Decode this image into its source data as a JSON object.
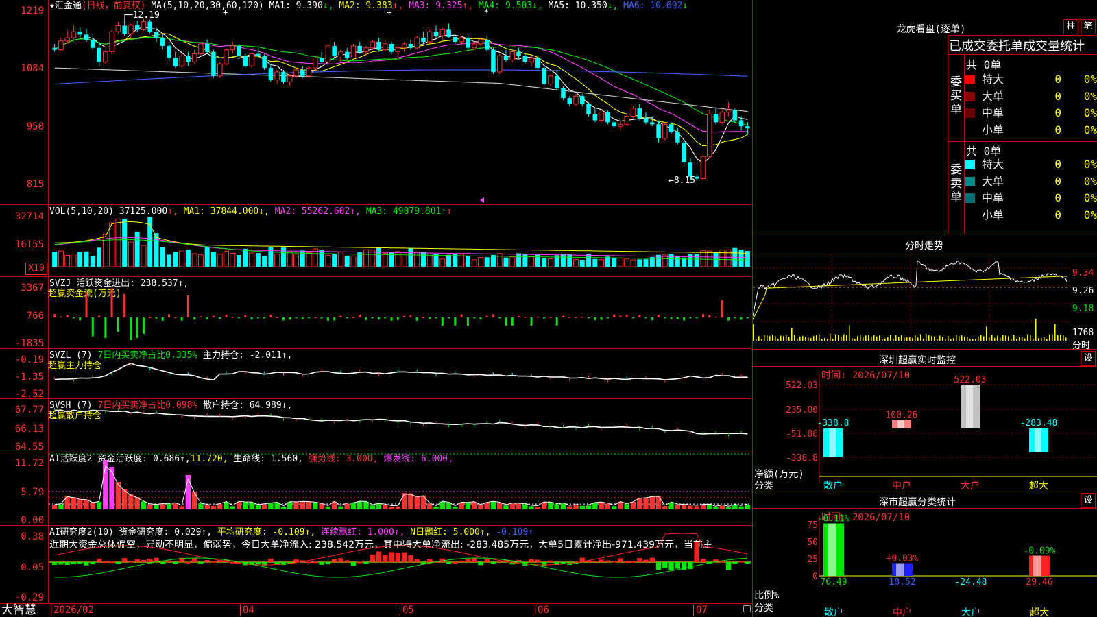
{
  "main": {
    "stock_name": "汇金通",
    "mode": "(日线，前复权)",
    "star_icon": "★",
    "ma_label": "MA(5,10,20,30,60,120)",
    "ma_values": [
      {
        "label": "MA1: 9.390",
        "arrow": "↓",
        "color": "#ffffff"
      },
      {
        "label": "MA2: 9.383",
        "arrow": "↑",
        "color": "#ffff00"
      },
      {
        "label": "MA3: 9.325",
        "arrow": "↑",
        "color": "#ff40ff"
      },
      {
        "label": "MA4: 9.503",
        "arrow": "↓",
        "color": "#00e600"
      },
      {
        "label": "MA5: 10.350",
        "arrow": "↓",
        "color": "#ffffff"
      },
      {
        "label": "MA6: 10.692",
        "arrow": "↓",
        "color": "#4060ff"
      }
    ],
    "y_ticks": [
      "1219",
      "1084",
      "950",
      "815"
    ],
    "high_label": "12.19",
    "low_label": "8.15"
  },
  "vol": {
    "label": "VOL(5,10,20)",
    "value": "37125.000",
    "ma1": "MA1: 37844.000↓,",
    "ma2": "MA2: 55262.602↑,",
    "ma3": "MA3: 49079.801↑",
    "y_ticks": [
      "32714",
      "16155"
    ],
    "unit": "X10"
  },
  "svzj": {
    "label": "SVZJ  活跃资金进出: 238.537↑,",
    "sub": "超赢资金流(万元)",
    "y_ticks": [
      "3367",
      "766",
      "-1835"
    ]
  },
  "svzl": {
    "label_a": "SVZL (7) ",
    "label_b": "7日内买卖净占比0.335%",
    "label_c": " 主力持仓: -2.011↑,",
    "sub": "超赢主力持仓",
    "y_ticks": [
      "-0.19",
      "-1.35",
      "-2.52"
    ]
  },
  "svsh": {
    "label_a": "SVSH (7) ",
    "label_b": "7日内买卖净占比0.098%",
    "label_c": " 散户持仓: 64.989↓,",
    "sub": "超赢散户持仓",
    "y_ticks": [
      "67.77",
      "66.13",
      "64.55"
    ]
  },
  "ai1": {
    "label_a": "AI活跃度2 资金活跃度: 0.686↑,",
    "label_b": "11.720,",
    "label_c": " 生命线: 1.560,",
    "label_d": " 强势线: 3.000,",
    "label_e": " 爆发线: 6.000,",
    "y_ticks": [
      "11.72",
      "5.79",
      "0.00"
    ]
  },
  "ai2": {
    "label_a": "AI研究度2(10) 资金研究度: 0.029↑,",
    "label_b": " 平均研究度: -0.109↑,",
    "label_c": " 连续飘红: 1.000↑,",
    "label_d": " N日飘红: 5.000↑,",
    "label_e": " -0.109↑",
    "comment": "近期大资金总体偏空，异动不明显，偏弱势，今日大单净流入: 238.542万元，其中特大单净流出: -283.485万元，大单5日累计净出-971.439万元，当前主",
    "y_ticks": [
      "0.38",
      "0.05",
      "-0.29"
    ]
  },
  "x_axis": [
    "2026/02",
    "04",
    "05",
    "06",
    "07"
  ],
  "logo": "大智慧",
  "right": {
    "dragon_title": "龙虎看盘(逐单)",
    "btn_bar": "柱",
    "btn_pen": "笔",
    "deal_header": "已成交委托单成交量统计",
    "buy_total": "共 0单",
    "sell_total": "共 0单",
    "buy_label": "委买单",
    "sell_label": "委卖单",
    "buy_rows": [
      {
        "name": "特大",
        "count": "0",
        "pct": "0%",
        "color": "#ff0000"
      },
      {
        "name": "大单",
        "count": "0",
        "pct": "0%",
        "color": "#8b0000"
      },
      {
        "name": "中单",
        "count": "0",
        "pct": "0%",
        "color": "#6b0000"
      },
      {
        "name": "小单",
        "count": "0",
        "pct": "0%",
        "color": "#000000"
      }
    ],
    "sell_rows": [
      {
        "name": "特大",
        "count": "0",
        "pct": "0%",
        "color": "#00ffff"
      },
      {
        "name": "大单",
        "count": "0",
        "pct": "0%",
        "color": "#008b8b"
      },
      {
        "name": "中单",
        "count": "0",
        "pct": "0%",
        "color": "#007070"
      },
      {
        "name": "小单",
        "count": "0",
        "pct": "0%",
        "color": "#000000"
      }
    ],
    "intraday_title": "分时走势",
    "intraday_prices": [
      "9.34",
      "9.26",
      "9.18"
    ],
    "intraday_vol": "1768",
    "intraday_vol_unit": "分时",
    "sz_title": "深圳超赢实时监控",
    "sz_btn": "设",
    "sz_time": "时间: 2026/07/10",
    "sz_y_ticks": [
      "522.03",
      "235.08",
      "-51.86",
      "-338.8"
    ],
    "sz_ylabel": "净额(万元)",
    "sz_xlabel": "分类",
    "sz_bars": [
      {
        "cat": "散户",
        "value": "-338.8",
        "num": -338.8,
        "color": "#00ffff"
      },
      {
        "cat": "中户",
        "value": "100.26",
        "num": 100.26,
        "color": "#ff8080"
      },
      {
        "cat": "大户",
        "value": "522.03",
        "num": 522.03,
        "color": "#c0c0c0"
      },
      {
        "cat": "超大",
        "value": "-283.48",
        "num": -283.48,
        "color": "#00ffff"
      }
    ],
    "cls_title": "深市超赢分类统计",
    "cls_btn": "设",
    "cls_time": "时间: 2026/07/10",
    "cls_y_ticks": [
      "75",
      "50",
      "25",
      "0"
    ],
    "cls_ylabel": "比例%",
    "cls_xlabel": "分类",
    "cls_bars": [
      {
        "cat": "散户",
        "top": "-0.11%",
        "bottom": "76.49",
        "num": 76.49,
        "color": "#00e600"
      },
      {
        "cat": "中户",
        "top": "+0.03%",
        "bottom": "18.52",
        "num": 18.52,
        "color": "#2020ff"
      },
      {
        "cat": "大户",
        "top": "",
        "bottom": "-24.48",
        "num": 0,
        "color": "#00ffff"
      },
      {
        "cat": "超大",
        "top": "-0.09%",
        "bottom": "29.46",
        "num": 29.46,
        "color": "#ff2020"
      }
    ]
  },
  "chart_data": {
    "type": "candlestick",
    "title": "汇金通",
    "price_range": [
      7.8,
      12.4
    ],
    "n_days": 110,
    "candles": [
      [
        11.45,
        11.55,
        11.35,
        11.4
      ],
      [
        11.4,
        11.7,
        11.38,
        11.62
      ],
      [
        11.62,
        11.9,
        11.55,
        11.7
      ],
      [
        11.7,
        12.0,
        11.6,
        11.85
      ],
      [
        11.85,
        11.95,
        11.7,
        11.78
      ],
      [
        11.78,
        11.92,
        11.6,
        11.65
      ],
      [
        11.65,
        11.8,
        11.4,
        11.45
      ],
      [
        11.45,
        11.6,
        11.0,
        11.1
      ],
      [
        11.1,
        11.4,
        11.05,
        11.35
      ],
      [
        11.35,
        11.9,
        11.3,
        11.85
      ],
      [
        11.85,
        12.1,
        11.8,
        12.0
      ],
      [
        12.0,
        12.15,
        11.75,
        11.8
      ],
      [
        11.8,
        12.05,
        11.7,
        12.02
      ],
      [
        12.02,
        12.12,
        11.85,
        11.9
      ],
      [
        11.9,
        12.19,
        11.88,
        12.1
      ],
      [
        12.1,
        12.15,
        11.8,
        11.85
      ],
      [
        11.85,
        11.95,
        11.6,
        11.7
      ],
      [
        11.7,
        11.8,
        11.4,
        11.5
      ],
      [
        11.5,
        11.6,
        11.1,
        11.2
      ],
      [
        11.2,
        11.35,
        10.95,
        11.0
      ],
      [
        11.0,
        11.3,
        10.95,
        11.25
      ],
      [
        11.25,
        11.35,
        11.0,
        11.1
      ],
      [
        11.1,
        11.4,
        11.05,
        11.3
      ],
      [
        11.3,
        11.6,
        11.25,
        11.55
      ],
      [
        11.55,
        11.65,
        11.3,
        11.35
      ],
      [
        11.35,
        11.4,
        10.7,
        10.75
      ],
      [
        10.75,
        11.1,
        10.7,
        11.05
      ],
      [
        11.05,
        11.45,
        11.0,
        11.4
      ],
      [
        11.4,
        11.6,
        11.3,
        11.5
      ],
      [
        11.5,
        11.55,
        11.2,
        11.25
      ],
      [
        11.25,
        11.3,
        10.95,
        11.0
      ],
      [
        11.0,
        11.35,
        10.95,
        11.3
      ],
      [
        11.3,
        11.5,
        11.2,
        11.25
      ],
      [
        11.25,
        11.3,
        10.9,
        10.95
      ],
      [
        10.95,
        11.05,
        10.6,
        10.65
      ],
      [
        10.65,
        10.9,
        10.55,
        10.85
      ],
      [
        10.85,
        10.9,
        10.55,
        10.6
      ],
      [
        10.6,
        10.8,
        10.5,
        10.75
      ],
      [
        10.75,
        10.95,
        10.7,
        10.9
      ],
      [
        10.9,
        11.0,
        10.7,
        10.75
      ],
      [
        10.75,
        11.0,
        10.7,
        10.95
      ],
      [
        10.95,
        11.25,
        10.9,
        11.2
      ],
      [
        11.2,
        11.35,
        11.05,
        11.1
      ],
      [
        11.1,
        11.55,
        11.05,
        11.5
      ],
      [
        11.5,
        11.6,
        11.2,
        11.25
      ],
      [
        11.25,
        11.4,
        11.1,
        11.35
      ],
      [
        11.35,
        11.45,
        11.15,
        11.2
      ],
      [
        11.2,
        11.55,
        11.15,
        11.5
      ],
      [
        11.5,
        11.6,
        11.3,
        11.35
      ],
      [
        11.35,
        11.5,
        11.25,
        11.45
      ],
      [
        11.45,
        11.65,
        11.4,
        11.6
      ],
      [
        11.6,
        11.7,
        11.35,
        11.4
      ],
      [
        11.4,
        11.65,
        11.35,
        11.55
      ],
      [
        11.55,
        11.6,
        11.3,
        11.35
      ],
      [
        11.35,
        11.5,
        11.2,
        11.45
      ],
      [
        11.45,
        11.6,
        11.35,
        11.55
      ],
      [
        11.55,
        11.65,
        11.4,
        11.45
      ],
      [
        11.45,
        11.75,
        11.4,
        11.7
      ],
      [
        11.7,
        11.85,
        11.55,
        11.6
      ],
      [
        11.6,
        11.9,
        11.55,
        11.85
      ],
      [
        11.85,
        12.0,
        11.7,
        11.75
      ],
      [
        11.75,
        11.95,
        11.65,
        11.9
      ],
      [
        11.9,
        12.05,
        11.7,
        11.72
      ],
      [
        11.72,
        11.8,
        11.55,
        11.6
      ],
      [
        11.6,
        11.75,
        11.5,
        11.7
      ],
      [
        11.7,
        11.8,
        11.4,
        11.45
      ],
      [
        11.45,
        11.6,
        11.35,
        11.55
      ],
      [
        11.55,
        11.7,
        11.5,
        11.65
      ],
      [
        11.65,
        11.75,
        11.35,
        11.4
      ],
      [
        11.4,
        11.45,
        10.8,
        10.85
      ],
      [
        10.85,
        11.3,
        10.8,
        11.25
      ],
      [
        11.25,
        11.4,
        11.1,
        11.15
      ],
      [
        11.15,
        11.4,
        11.1,
        11.35
      ],
      [
        11.35,
        11.45,
        11.2,
        11.25
      ],
      [
        11.25,
        11.3,
        11.05,
        11.1
      ],
      [
        11.1,
        11.25,
        11.0,
        11.2
      ],
      [
        11.2,
        11.25,
        10.9,
        10.95
      ],
      [
        10.95,
        11.0,
        10.5,
        10.55
      ],
      [
        10.55,
        10.8,
        10.5,
        10.75
      ],
      [
        10.75,
        10.9,
        10.4,
        10.45
      ],
      [
        10.45,
        10.5,
        10.15,
        10.2
      ],
      [
        10.2,
        10.25,
        10.0,
        10.05
      ],
      [
        10.05,
        10.3,
        10.0,
        10.25
      ],
      [
        10.25,
        10.3,
        10.0,
        10.05
      ],
      [
        10.05,
        10.1,
        9.75,
        9.8
      ],
      [
        9.8,
        9.95,
        9.6,
        9.65
      ],
      [
        9.65,
        9.9,
        9.6,
        9.85
      ],
      [
        9.85,
        9.9,
        9.55,
        9.6
      ],
      [
        9.6,
        9.7,
        9.45,
        9.5
      ],
      [
        9.5,
        9.65,
        9.4,
        9.55
      ],
      [
        9.55,
        9.8,
        9.5,
        9.75
      ],
      [
        9.75,
        10.0,
        9.7,
        9.95
      ],
      [
        9.95,
        10.05,
        9.65,
        9.7
      ],
      [
        9.7,
        9.85,
        9.55,
        9.6
      ],
      [
        9.6,
        9.75,
        9.5,
        9.55
      ],
      [
        9.55,
        9.65,
        9.1,
        9.2
      ],
      [
        9.2,
        9.6,
        9.15,
        9.55
      ],
      [
        9.55,
        9.6,
        9.3,
        9.35
      ],
      [
        9.35,
        9.45,
        9.05,
        9.1
      ],
      [
        9.1,
        9.15,
        8.5,
        8.6
      ],
      [
        8.6,
        8.7,
        8.15,
        8.25
      ],
      [
        8.25,
        8.3,
        8.15,
        8.2
      ],
      [
        8.2,
        8.8,
        8.15,
        8.75
      ],
      [
        8.75,
        9.9,
        8.7,
        9.8
      ],
      [
        9.8,
        9.95,
        9.55,
        9.6
      ],
      [
        9.6,
        9.95,
        9.55,
        9.85
      ],
      [
        9.85,
        10.1,
        9.75,
        9.9
      ],
      [
        9.9,
        9.95,
        9.6,
        9.65
      ],
      [
        9.65,
        9.75,
        9.4,
        9.5
      ],
      [
        9.5,
        9.6,
        9.3,
        9.45
      ]
    ],
    "ma_lines": [
      {
        "name": "MA1",
        "color": "#ffffff",
        "start": 11.5,
        "end": 9.39
      },
      {
        "name": "MA2",
        "color": "#ffff00",
        "start": 11.6,
        "end": 9.38
      },
      {
        "name": "MA3",
        "color": "#ff40ff",
        "start": 11.5,
        "end": 9.33
      },
      {
        "name": "MA4",
        "color": "#00e600",
        "start": 11.3,
        "end": 9.5
      },
      {
        "name": "MA5",
        "color": "#cccccc",
        "start": 10.9,
        "end": 10.35
      },
      {
        "name": "MA6",
        "color": "#4060ff",
        "start": 10.6,
        "end": 10.69
      }
    ]
  }
}
